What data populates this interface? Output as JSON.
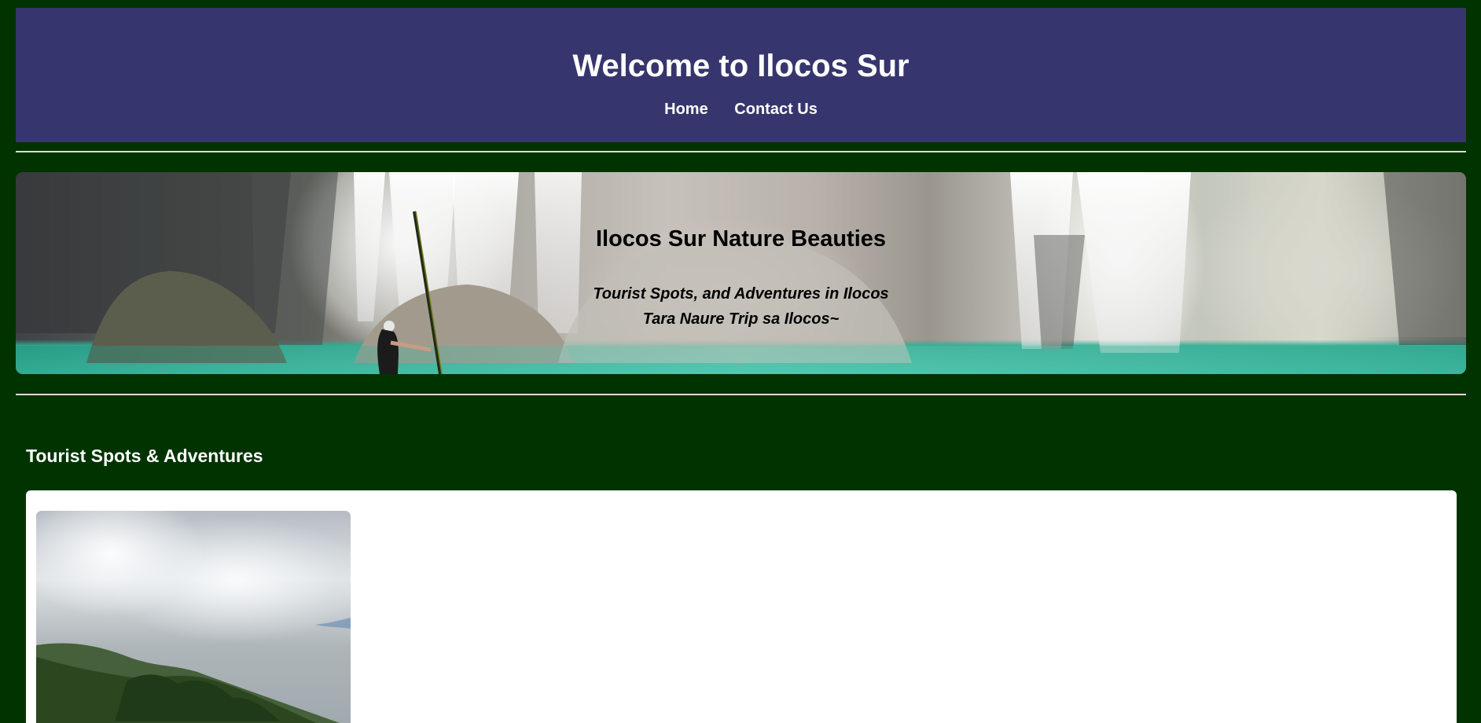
{
  "header": {
    "title": "Welcome to Ilocos Sur",
    "nav": [
      {
        "label": "Home"
      },
      {
        "label": "Contact Us"
      }
    ]
  },
  "hero": {
    "title": "Ilocos Sur Nature Beauties",
    "subtitle_line1": "Tourist Spots, and Adventures in Ilocos",
    "subtitle_line2": "Tara Naure Trip sa Ilocos~"
  },
  "section": {
    "title": "Tourist Spots & Adventures"
  },
  "colors": {
    "page_background": "#003300",
    "header_background": "#36356d",
    "text_light": "#ffffff",
    "card_background": "#ffffff"
  }
}
